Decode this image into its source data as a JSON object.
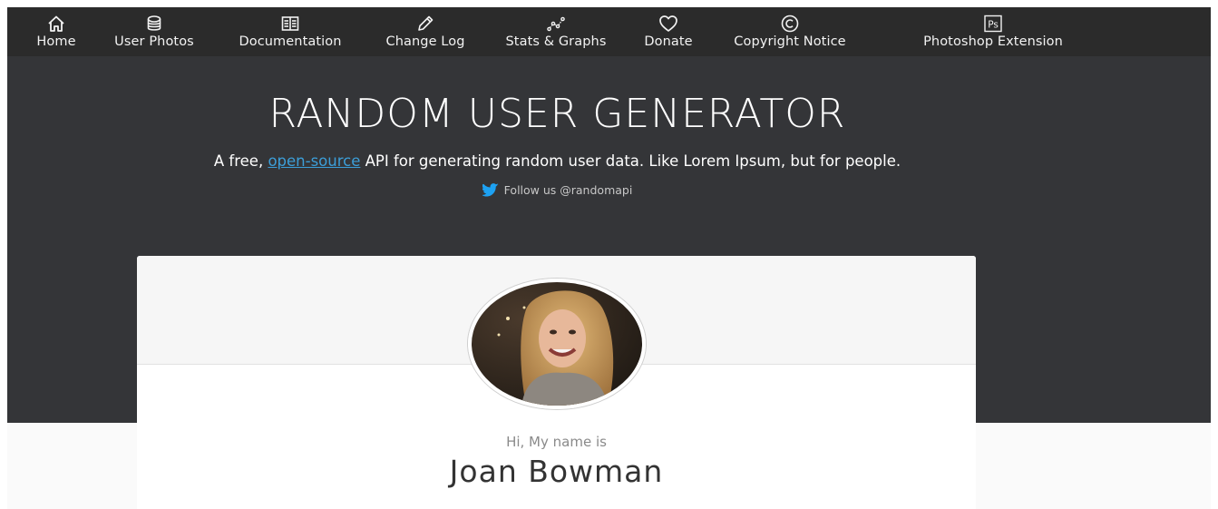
{
  "nav": {
    "items": [
      {
        "label": "Home",
        "icon": "home-icon"
      },
      {
        "label": "User Photos",
        "icon": "coins-icon"
      },
      {
        "label": "Documentation",
        "icon": "book-icon"
      },
      {
        "label": "Change Log",
        "icon": "pencil-icon"
      },
      {
        "label": "Stats & Graphs",
        "icon": "graph-icon"
      },
      {
        "label": "Donate",
        "icon": "heart-icon"
      },
      {
        "label": "Copyright Notice",
        "icon": "copyright-icon"
      },
      {
        "label": "Photoshop Extension",
        "icon": "photoshop-icon",
        "icon_text": "Ps"
      }
    ]
  },
  "hero": {
    "title": "RANDOM USER GENERATOR",
    "subtitle_prefix": "A free, ",
    "subtitle_link": "open-source",
    "subtitle_suffix": " API for generating random user data. Like Lorem Ipsum, but for people.",
    "follow_text": "Follow us @randomapi"
  },
  "card": {
    "greeting": "Hi, My name is",
    "name": "Joan Bowman"
  },
  "colors": {
    "navbar_bg": "#2b2b2b",
    "hero_bg": "#343538",
    "link": "#3c9ed8",
    "twitter": "#1da1f2"
  }
}
